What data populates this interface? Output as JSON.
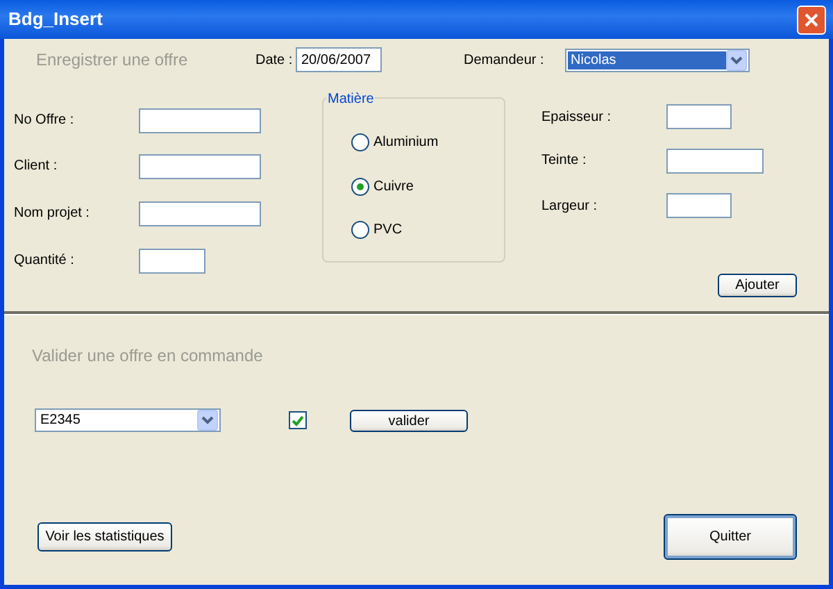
{
  "window": {
    "title": "Bdg_Insert"
  },
  "offer_section": {
    "title": "Enregistrer une offre",
    "date": {
      "label": "Date :",
      "value": "20/06/2007"
    },
    "demandeur": {
      "label": "Demandeur :",
      "value": "Nicolas"
    },
    "left_fields": [
      {
        "label": "No Offre :"
      },
      {
        "label": "Client :"
      },
      {
        "label": "Nom projet :"
      },
      {
        "label": "Quantité :"
      }
    ],
    "matiere": {
      "title": "Matière",
      "options": [
        {
          "label": "Aluminium",
          "selected": false
        },
        {
          "label": "Cuivre",
          "selected": true
        },
        {
          "label": "PVC",
          "selected": false
        }
      ]
    },
    "right_fields": [
      {
        "label": "Epaisseur :"
      },
      {
        "label": "Teinte :"
      },
      {
        "label": "Largeur :"
      }
    ],
    "add_button": "Ajouter"
  },
  "validate_section": {
    "title": "Valider une offre en commande",
    "offer": {
      "value": "E2345"
    },
    "confirmed": {
      "checked": true
    },
    "validate_button": "valider"
  },
  "buttons": [
    "Voir les statistiques",
    "Quitter"
  ]
}
